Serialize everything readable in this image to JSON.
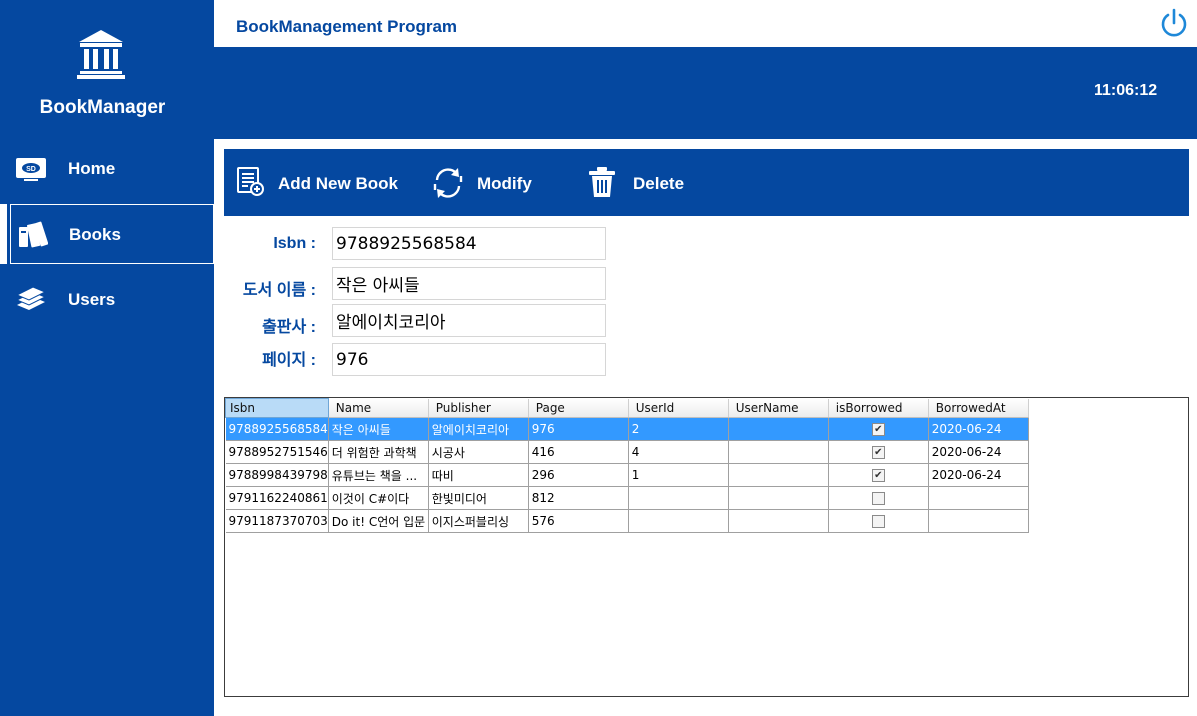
{
  "app": {
    "name": "BookManager",
    "window_title": "BookManagement Program",
    "clock": "11:06:12"
  },
  "nav": [
    {
      "label": "Home",
      "icon": "home-icon"
    },
    {
      "label": "Books",
      "icon": "books-icon",
      "active": true
    },
    {
      "label": "Users",
      "icon": "users-icon"
    }
  ],
  "toolbar": {
    "add_label": "Add New Book",
    "modify_label": "Modify",
    "delete_label": "Delete"
  },
  "form": {
    "isbn_label": "Isbn :",
    "isbn_value": "9788925568584",
    "name_label": "도서 이름 :",
    "name_value": "작은 아씨들",
    "publisher_label": "출판사 :",
    "publisher_value": "알에이치코리아",
    "page_label": "페이지 :",
    "page_value": "976"
  },
  "grid": {
    "columns": [
      "Isbn",
      "Name",
      "Publisher",
      "Page",
      "UserId",
      "UserName",
      "isBorrowed",
      "BorrowedAt"
    ],
    "rows": [
      {
        "isbn": "9788925568584",
        "name": "작은 아씨들",
        "publisher": "알에이치코리아",
        "page": "976",
        "userid": "2",
        "username": "",
        "borrowed": true,
        "borrowed_at": "2020-06-24",
        "selected": true
      },
      {
        "isbn": "9788952751546",
        "name": "더 위험한 과학책",
        "publisher": "시공사",
        "page": "416",
        "userid": "4",
        "username": "",
        "borrowed": true,
        "borrowed_at": "2020-06-24"
      },
      {
        "isbn": "9788998439798",
        "name": "유튜브는 책을 ...",
        "publisher": "따비",
        "page": "296",
        "userid": "1",
        "username": "",
        "borrowed": true,
        "borrowed_at": "2020-06-24"
      },
      {
        "isbn": "9791162240861",
        "name": "이것이 C#이다",
        "publisher": "한빛미디어",
        "page": "812",
        "userid": "",
        "username": "",
        "borrowed": false,
        "borrowed_at": ""
      },
      {
        "isbn": "9791187370703",
        "name": "Do it! C언어 입문",
        "publisher": "이지스퍼블리싱",
        "page": "576",
        "userid": "",
        "username": "",
        "borrowed": false,
        "borrowed_at": ""
      }
    ]
  },
  "colors": {
    "primary": "#0548a0",
    "selection": "#3399ff"
  }
}
